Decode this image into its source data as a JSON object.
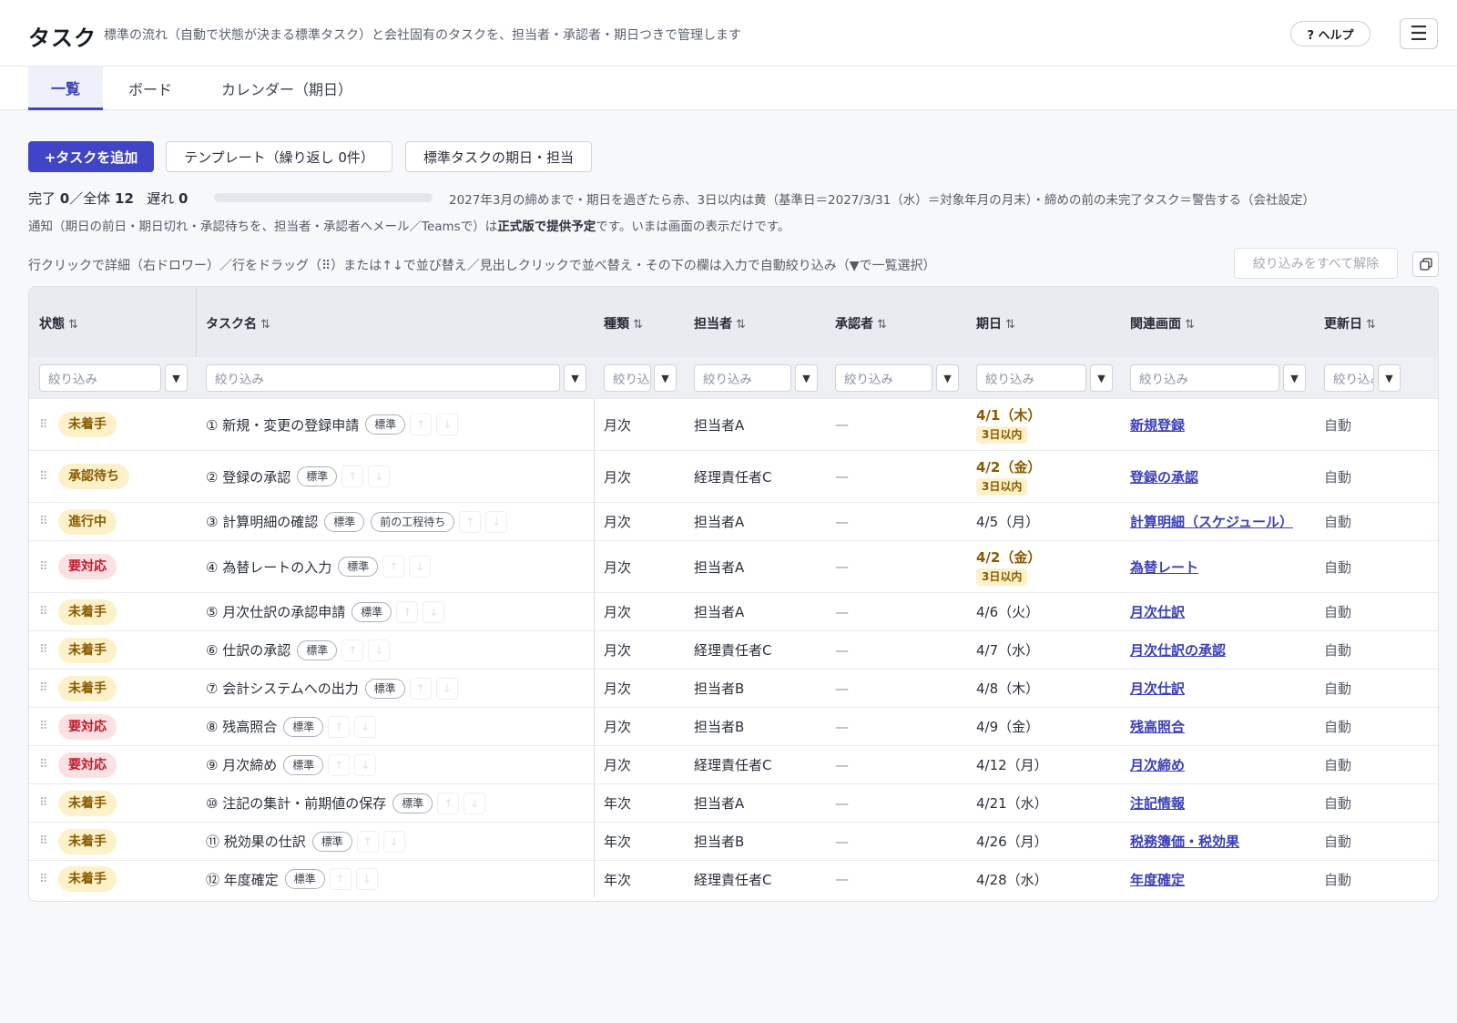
{
  "header": {
    "title": "タスク",
    "subtitle": "標準の流れ（自動で状態が決まる標準タスク）と会社固有のタスクを、担当者・承認者・期日つきで管理します",
    "help_label": "? ヘルプ"
  },
  "tabs": [
    "一覧",
    "ボード",
    "カレンダー（期日）"
  ],
  "toolbar": {
    "add_label": "+タスクを追加",
    "template_label": "テンプレート（繰り返し 0件）",
    "standard_label": "標準タスクの期日・担当"
  },
  "stats": {
    "done_label": "完了",
    "done": "0",
    "total_label": "／全体",
    "total": "12",
    "late_label": "遅れ",
    "late": "0",
    "progress": 0
  },
  "rule_text": "2027年3月の締めまで・期日を過ぎたら赤、3日以内は黄（基準日＝2027/3/31（水）＝対象年月の月末）・締めの前の未完了タスク＝警告する（会社設定）",
  "notify": {
    "before": "通知（期日の前日・期日切れ・承認待ちを、担当者・承認者へメール／Teamsで）は",
    "bold": "正式版で提供予定",
    "after": "です。いまは画面の表示だけです。"
  },
  "hint": "行クリックで詳細（右ドロワー）／行をドラッグ（⠿）または↑↓で並び替え／見出しクリックで並べ替え・その下の欄は入力で自動絞り込み（▼で一覧選択）",
  "clear_filters_label": "絞り込みをすべて解除",
  "columns": {
    "status": "状態",
    "name": "タスク名",
    "kind": "種類",
    "assignee": "担当者",
    "approver": "承認者",
    "due": "期日",
    "screen": "関連画面",
    "updated": "更新日",
    "sort_glyph": "⇅"
  },
  "filter_placeholder": "絞り込み",
  "rows": [
    {
      "status": "未着手",
      "status_class": "s-todo",
      "name": "① 新規・変更の登録申請",
      "tags": [
        "標準"
      ],
      "kind": "月次",
      "assignee": "担当者A",
      "approver": "—",
      "due": "4/1（木）",
      "due_warn": true,
      "due_badge": "3日以内",
      "screen": "新規登録",
      "updated": "自動"
    },
    {
      "status": "承認待ち",
      "status_class": "s-wait",
      "name": "② 登録の承認",
      "tags": [
        "標準"
      ],
      "kind": "月次",
      "assignee": "経理責任者C",
      "approver": "—",
      "due": "4/2（金）",
      "due_warn": true,
      "due_badge": "3日以内",
      "screen": "登録の承認",
      "updated": "自動"
    },
    {
      "status": "進行中",
      "status_class": "s-prog",
      "name": "③ 計算明細の確認",
      "tags": [
        "標準",
        "前の工程待ち"
      ],
      "kind": "月次",
      "assignee": "担当者A",
      "approver": "—",
      "due": "4/5（月）",
      "due_warn": false,
      "due_badge": "",
      "screen": "計算明細（スケジュール）",
      "updated": "自動"
    },
    {
      "status": "要対応",
      "status_class": "s-need",
      "name": "④ 為替レートの入力",
      "tags": [
        "標準"
      ],
      "kind": "月次",
      "assignee": "担当者A",
      "approver": "—",
      "due": "4/2（金）",
      "due_warn": true,
      "due_badge": "3日以内",
      "screen": "為替レート",
      "updated": "自動"
    },
    {
      "status": "未着手",
      "status_class": "s-todo",
      "name": "⑤ 月次仕訳の承認申請",
      "tags": [
        "標準"
      ],
      "kind": "月次",
      "assignee": "担当者A",
      "approver": "—",
      "due": "4/6（火）",
      "due_warn": false,
      "due_badge": "",
      "screen": "月次仕訳",
      "updated": "自動"
    },
    {
      "status": "未着手",
      "status_class": "s-todo",
      "name": "⑥ 仕訳の承認",
      "tags": [
        "標準"
      ],
      "kind": "月次",
      "assignee": "経理責任者C",
      "approver": "—",
      "due": "4/7（水）",
      "due_warn": false,
      "due_badge": "",
      "screen": "月次仕訳の承認",
      "updated": "自動"
    },
    {
      "status": "未着手",
      "status_class": "s-todo",
      "name": "⑦ 会計システムへの出力",
      "tags": [
        "標準"
      ],
      "kind": "月次",
      "assignee": "担当者B",
      "approver": "—",
      "due": "4/8（木）",
      "due_warn": false,
      "due_badge": "",
      "screen": "月次仕訳",
      "updated": "自動"
    },
    {
      "status": "要対応",
      "status_class": "s-need",
      "name": "⑧ 残高照合",
      "tags": [
        "標準"
      ],
      "kind": "月次",
      "assignee": "担当者B",
      "approver": "—",
      "due": "4/9（金）",
      "due_warn": false,
      "due_badge": "",
      "screen": "残高照合",
      "updated": "自動"
    },
    {
      "status": "要対応",
      "status_class": "s-need",
      "name": "⑨ 月次締め",
      "tags": [
        "標準"
      ],
      "kind": "月次",
      "assignee": "経理責任者C",
      "approver": "—",
      "due": "4/12（月）",
      "due_warn": false,
      "due_badge": "",
      "screen": "月次締め",
      "updated": "自動"
    },
    {
      "status": "未着手",
      "status_class": "s-todo",
      "name": "⑩ 注記の集計・前期値の保存",
      "tags": [
        "標準"
      ],
      "kind": "年次",
      "assignee": "担当者A",
      "approver": "—",
      "due": "4/21（水）",
      "due_warn": false,
      "due_badge": "",
      "screen": "注記情報",
      "updated": "自動"
    },
    {
      "status": "未着手",
      "status_class": "s-todo",
      "name": "⑪ 税効果の仕訳",
      "tags": [
        "標準"
      ],
      "kind": "年次",
      "assignee": "担当者B",
      "approver": "—",
      "due": "4/26（月）",
      "due_warn": false,
      "due_badge": "",
      "screen": "税務簿価・税効果",
      "updated": "自動"
    },
    {
      "status": "未着手",
      "status_class": "s-todo",
      "name": "⑫ 年度確定",
      "tags": [
        "標準"
      ],
      "kind": "年次",
      "assignee": "経理責任者C",
      "approver": "—",
      "due": "4/28（水）",
      "due_warn": false,
      "due_badge": "",
      "screen": "年度確定",
      "updated": "自動"
    }
  ],
  "icons": {
    "grip": "⠿",
    "move_up": "↑",
    "move_down": "↓",
    "dropdown": "▼",
    "menu": "☰"
  },
  "colors": {
    "accent": "#4044c6",
    "warn": "#8a5a00",
    "danger": "#c0182a"
  }
}
